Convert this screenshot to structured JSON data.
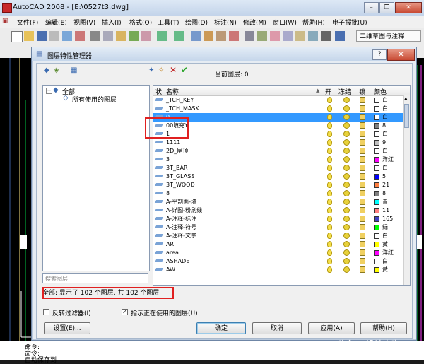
{
  "app": {
    "title": "AutoCAD 2008 - [E:\\0527t3.dwg]",
    "menu": [
      "文件(F)",
      "编辑(E)",
      "视图(V)",
      "插入(I)",
      "格式(O)",
      "工具(T)",
      "绘图(D)",
      "标注(N)",
      "修改(M)",
      "窗口(W)",
      "帮助(H)",
      "电子报批(U)"
    ],
    "workspace": "二维草图与注释",
    "command_lines": [
      "命令:",
      "命令:",
      "自动保存到"
    ]
  },
  "dialog": {
    "title": "图层特性管理器",
    "current_layer_label": "当前图层: 0",
    "tree": {
      "root": "全部",
      "child": "所有使用的图层"
    },
    "search_placeholder": "搜索图层",
    "columns": [
      "状",
      "名称",
      "开",
      "冻结",
      "锁",
      "颜色"
    ],
    "rows": [
      {
        "name": "_TCH_KEY",
        "color_name": "白",
        "color": "#ffffff",
        "selected": false
      },
      {
        "name": "_TCH_MASK",
        "color_name": "白",
        "color": "#ffffff",
        "selected": false
      },
      {
        "name": "0",
        "color_name": "白",
        "color": "#ffffff",
        "selected": true
      },
      {
        "name": "00填充Y",
        "color_name": "8",
        "color": "#808080",
        "selected": false
      },
      {
        "name": "1",
        "color_name": "白",
        "color": "#ffffff",
        "selected": false
      },
      {
        "name": "1111",
        "color_name": "9",
        "color": "#c0c0c0",
        "selected": false
      },
      {
        "name": "2D_屋顶",
        "color_name": "白",
        "color": "#ffffff",
        "selected": false
      },
      {
        "name": "3",
        "color_name": "洋红",
        "color": "#ff00ff",
        "selected": false
      },
      {
        "name": "3T_BAR",
        "color_name": "白",
        "color": "#ffffff",
        "selected": false
      },
      {
        "name": "3T_GLASS",
        "color_name": "5",
        "color": "#0000ff",
        "selected": false
      },
      {
        "name": "3T_WOOD",
        "color_name": "21",
        "color": "#ff7f3f",
        "selected": false
      },
      {
        "name": "8",
        "color_name": "8",
        "color": "#808080",
        "selected": false
      },
      {
        "name": "A-平剖面-墙",
        "color_name": "青",
        "color": "#00ffff",
        "selected": false
      },
      {
        "name": "A-详图-粉刷线",
        "color_name": "11",
        "color": "#ff7f7f",
        "selected": false
      },
      {
        "name": "A-注释-标注",
        "color_name": "165",
        "color": "#3f3fbf",
        "selected": false
      },
      {
        "name": "A-注释-符号",
        "color_name": "绿",
        "color": "#00ff00",
        "selected": false
      },
      {
        "name": "A-注释-文字",
        "color_name": "白",
        "color": "#ffffff",
        "selected": false
      },
      {
        "name": "AR",
        "color_name": "黄",
        "color": "#ffff00",
        "selected": false
      },
      {
        "name": "area",
        "color_name": "洋红",
        "color": "#ff00ff",
        "selected": false
      },
      {
        "name": "ASHADE",
        "color_name": "白",
        "color": "#ffffff",
        "selected": false
      },
      {
        "name": "AW",
        "color_name": "黄",
        "color": "#ffff00",
        "selected": false
      }
    ],
    "status_text": "全部: 显示了 102 个图层, 共 102 个图层",
    "invert_filter_label": "反转过滤器(I)",
    "indicate_in_use_label": "指示正在使用的图层(U)",
    "buttons": {
      "settings": "设置(E)...",
      "ok": "确定",
      "cancel": "取消",
      "apply": "应用(A)",
      "help": "帮助(H)"
    }
  },
  "watermark": "头条 @设计大咖"
}
